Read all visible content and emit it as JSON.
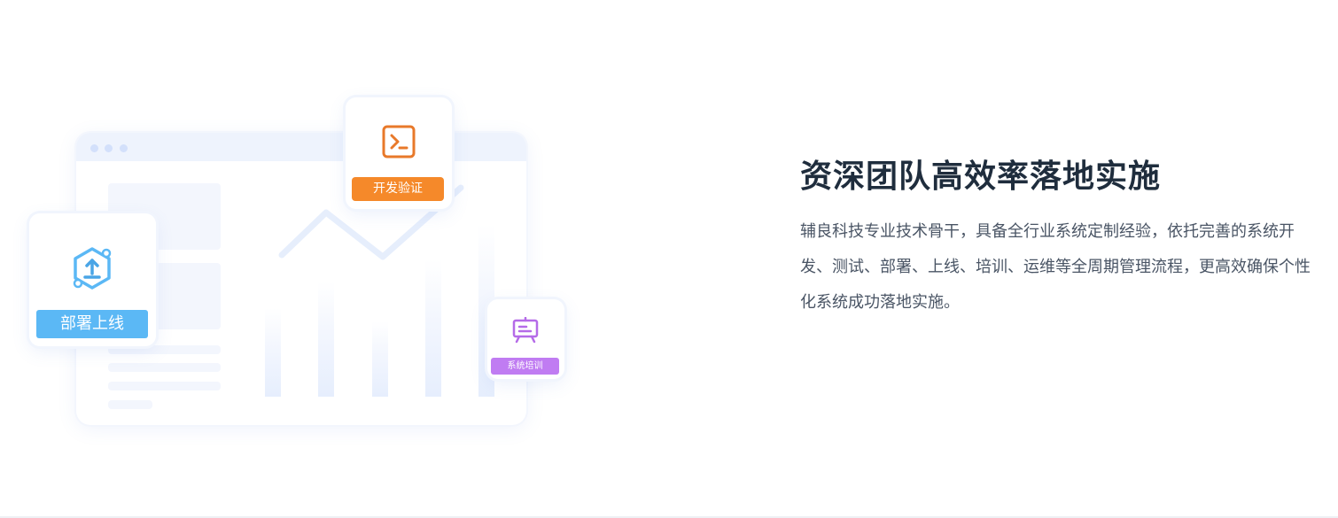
{
  "section": {
    "heading": "资深团队高效率落地实施",
    "description": "辅良科技专业技术骨干，具备全行业系统定制经验，依托完善的系统开发、测试、部署、上线、培训、运维等全周期管理流程，更高效确保个性化系统成功落地实施。"
  },
  "illustration": {
    "cards": {
      "dev": {
        "label": "开发验证",
        "icon": "terminal-icon",
        "color": "#f5892a"
      },
      "deploy": {
        "label": "部署上线",
        "icon": "upload-icon",
        "color": "#5bb8f5"
      },
      "training": {
        "label": "系统培训",
        "icon": "presentation-board-icon",
        "color": "#c07cf2"
      }
    }
  }
}
